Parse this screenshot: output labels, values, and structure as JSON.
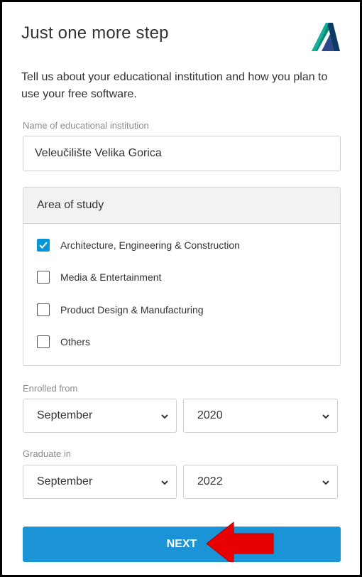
{
  "header": {
    "title": "Just one more step",
    "logo_icon": "autodesk-logo-icon"
  },
  "intro": {
    "text": "Tell us about your educational institution and how you plan to use your free software."
  },
  "institution": {
    "label": "Name of educational institution",
    "value": "Veleučilište Velika Gorica"
  },
  "study": {
    "header": "Area of study",
    "options": [
      {
        "label": "Architecture, Engineering & Construction",
        "checked": true
      },
      {
        "label": "Media & Entertainment",
        "checked": false
      },
      {
        "label": "Product Design & Manufacturing",
        "checked": false
      },
      {
        "label": "Others",
        "checked": false
      }
    ]
  },
  "enrolled": {
    "label": "Enrolled from",
    "month": "September",
    "year": "2020"
  },
  "graduate": {
    "label": "Graduate in",
    "month": "September",
    "year": "2022"
  },
  "next": {
    "label": "NEXT"
  },
  "colors": {
    "accent": "#1a94d6",
    "checkbox": "#0696d7",
    "arrow": "#e60000"
  }
}
